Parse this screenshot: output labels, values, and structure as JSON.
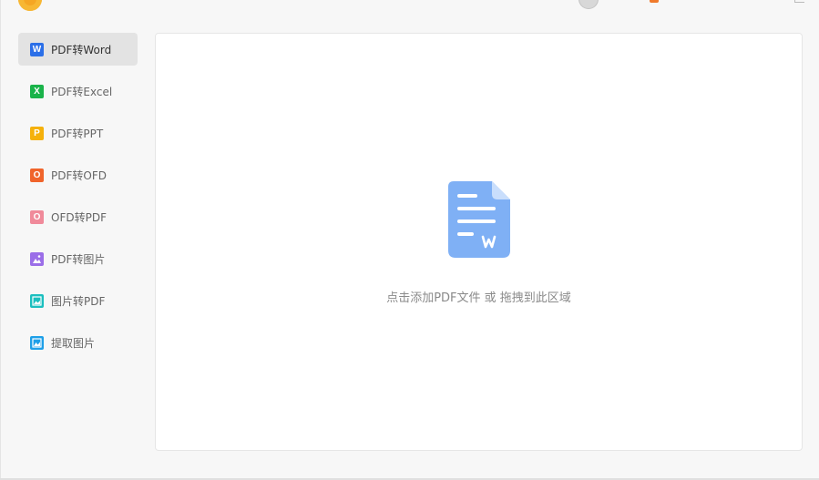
{
  "sidebar": {
    "items": [
      {
        "label": "PDF转Word",
        "icon": "word-icon",
        "glyph": "W",
        "color": "#2b6fe8",
        "active": true
      },
      {
        "label": "PDF转Excel",
        "icon": "excel-icon",
        "glyph": "X",
        "color": "#1ab34a",
        "active": false
      },
      {
        "label": "PDF转PPT",
        "icon": "ppt-icon",
        "glyph": "P",
        "color": "#f5b10b",
        "active": false
      },
      {
        "label": "PDF转OFD",
        "icon": "ofd-icon",
        "glyph": "O",
        "color": "#f0642b",
        "active": false
      },
      {
        "label": "OFD转PDF",
        "icon": "ofd-to-pdf-icon",
        "glyph": "O",
        "color": "#f08a9a",
        "active": false
      },
      {
        "label": "PDF转图片",
        "icon": "pdf-to-image-icon",
        "glyph": "",
        "color": "#9b6ee8",
        "active": false
      },
      {
        "label": "图片转PDF",
        "icon": "image-to-pdf-icon",
        "glyph": "",
        "color": "#1bbfbf",
        "active": false
      },
      {
        "label": "提取图片",
        "icon": "extract-image-icon",
        "glyph": "",
        "color": "#1e9fe8",
        "active": false
      }
    ]
  },
  "main": {
    "drop_hint": "点击添加PDF文件 或 拖拽到此区域",
    "doc_icon": "word-document-icon",
    "doc_color": "#7fb0f5"
  },
  "colors": {
    "active_bg": "#e3e3e3",
    "app_logo": "#f5a623"
  }
}
